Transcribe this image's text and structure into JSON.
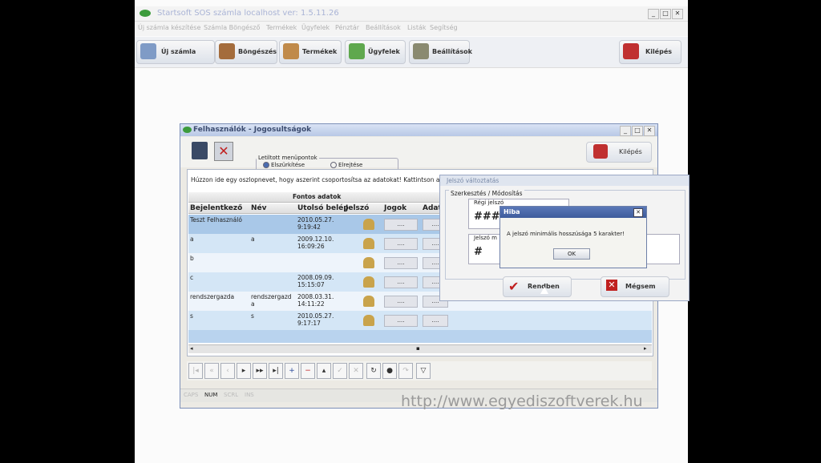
{
  "app": {
    "title": "Startsoft SOS számla     localhost ver: 1.5.11.26"
  },
  "menu": [
    "Új számla készítése",
    "Számla Böngésző",
    "Termékek",
    "Ügyfelek",
    "Pénztár",
    "Beállítások",
    "Listák",
    "Segítség"
  ],
  "toolbar": {
    "new_invoice": "Új számla",
    "browse": "Böngészés",
    "products": "Termékek",
    "customers": "Ügyfelek",
    "settings": "Beállítások",
    "exit": "Kilépés"
  },
  "users_window": {
    "title": "Felhasználók - Jogosultságok",
    "menu_group": "Letiltott menüpontok",
    "opt_gray": "Elszürkítése",
    "opt_hide": "Elrejtése",
    "exit": "Kilépés",
    "hint": "Húzzon ide egy oszlopnevet, hogy aszerint csoportosítsa az adatokat! Kattintson a",
    "band": "Fontos adatok",
    "columns": [
      "Bejelentkező",
      "Név",
      "Utolsó belép",
      "Jelszó",
      "Jogok",
      "Adat"
    ],
    "rows": [
      {
        "login": "Teszt Felhasználó",
        "name": "",
        "last": "2010.05.27. 9:19:42"
      },
      {
        "login": "a",
        "name": "a",
        "last": "2009.12.10. 16:09:26"
      },
      {
        "login": "b",
        "name": "",
        "last": ""
      },
      {
        "login": "c",
        "name": "",
        "last": "2008.09.09. 15:15:07"
      },
      {
        "login": "rendszergazda",
        "name": "rendszergazda",
        "last": "2008.03.31. 14:11:22"
      },
      {
        "login": "s",
        "name": "s",
        "last": "2010.05.27. 9:17:17"
      }
    ],
    "btn": "....",
    "status": [
      "CAPS",
      "NUM",
      "SCRL",
      "INS"
    ]
  },
  "edit_panel": {
    "title": "Jelszó változtatás",
    "group": "Szerkesztés / Módosítás",
    "old": "Régi jelszó",
    "old_val": "###",
    "new": "Jelszó m",
    "new_val": "#",
    "ok": "Rendben",
    "cancel": "Mégsem"
  },
  "dialog": {
    "title": "Hiba",
    "message": "A jelszó minimális hosszúsága 5 karakter!",
    "ok": "OK"
  },
  "watermark": "http://www.egyediszoftverek.hu"
}
